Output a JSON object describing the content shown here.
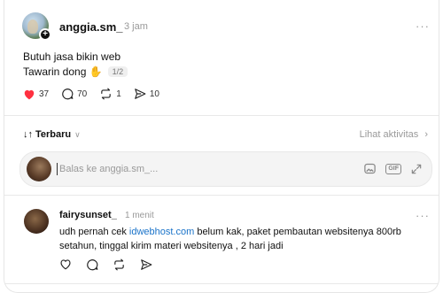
{
  "post": {
    "username": "anggia.sm_",
    "time": "3 jam",
    "line1": "Butuh jasa bikin web",
    "line2": "Tawarin dong ✋",
    "page_indicator": "1/2",
    "likes": "37",
    "comments": "70",
    "reposts": "1",
    "shares": "10",
    "more": "···"
  },
  "sort": {
    "label": "Terbaru",
    "activity": "Lihat aktivitas"
  },
  "reply": {
    "placeholder": "Balas ke anggia.sm_..."
  },
  "comment": {
    "username": "fairysunset_",
    "time": "1 menit",
    "text_before": "udh pernah cek ",
    "link": "idwebhost.com",
    "text_after": " belum kak, paket pembautan websitenya 800rb setahun, tinggal kirim materi websitenya , 2 hari jadi",
    "more": "···"
  },
  "colors": {
    "heart": "#ff3040",
    "link": "#1a73c9",
    "muted": "#999999"
  },
  "icons": [
    "heart-icon",
    "comment-icon",
    "repost-icon",
    "share-icon",
    "sort-icon",
    "chevron-down-icon",
    "chevron-right-icon",
    "image-icon",
    "gif-icon",
    "expand-icon",
    "plus-icon"
  ]
}
